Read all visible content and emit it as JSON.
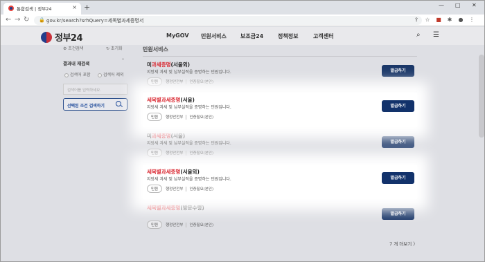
{
  "browser": {
    "tab_title": "통합검색 | 정부24",
    "new_tab": "+",
    "url": "gov.kr/search?srhQuery=세목별과세증명서",
    "window_controls": [
      "—",
      "□",
      "✕"
    ]
  },
  "header": {
    "logo_text": "정부24",
    "nav": [
      "MyGOV",
      "민원서비스",
      "보조금24",
      "정책정보",
      "고객센터"
    ],
    "icons": [
      "search-icon",
      "menu-icon"
    ]
  },
  "filter": {
    "tabs": [
      "조건검색",
      "초기화"
    ],
    "title": "결과내 재검색",
    "options": [
      "검색어 포함",
      "검색어 제외"
    ],
    "search_placeholder": "검색어를 입력하세요.",
    "apply_label": "선택된 조건 검색하기"
  },
  "results": {
    "section_title": "민원서비스",
    "items": [
      {
        "title_pre": "미",
        "title_hi": "과세증명",
        "title_post": "(서울외)",
        "desc": "지방세 과세 및 납부실적을 증명하는 민원입니다.",
        "badge": "민원",
        "agency": "행정안전부",
        "auth": "인증필요(본인)",
        "button": "발급하기",
        "highlight": false
      },
      {
        "title_pre": "",
        "title_hi": "세목별과세증명",
        "title_post": "(서울)",
        "desc": "지방세 과세 및 납부실적을 증명하는 민원입니다.",
        "badge": "민원",
        "agency": "행정안전부",
        "auth": "인증필요(본인)",
        "button": "발급하기",
        "highlight": true
      },
      {
        "title_pre": "미",
        "title_hi": "과세증명",
        "title_post": "(서울)",
        "desc": "지방세 과세 및 납부실적을 증명하는 민원입니다.",
        "badge": "민원",
        "agency": "행정안전부",
        "auth": "인증필요(본인)",
        "button": "발급하기",
        "highlight": false
      },
      {
        "title_pre": "",
        "title_hi": "세목별과세증명",
        "title_post": "(서울외)",
        "desc": "지방세 과세 및 납부실적을 증명하는 민원입니다.",
        "badge": "민원",
        "agency": "행정안전부",
        "auth": "인증필요(본인)",
        "button": "발급하기",
        "highlight": true
      },
      {
        "title_pre": "",
        "title_hi": "세목별과세증명",
        "title_post": "(방문수령)",
        "desc": "",
        "badge": "민원",
        "agency": "행정안전부",
        "auth": "인증필요(본인)",
        "button": "발급하기",
        "highlight": false
      }
    ],
    "more": "7 개 더보기 〉"
  },
  "colors": {
    "accent_red": "#d9262f",
    "button_navy": "#12326b"
  }
}
